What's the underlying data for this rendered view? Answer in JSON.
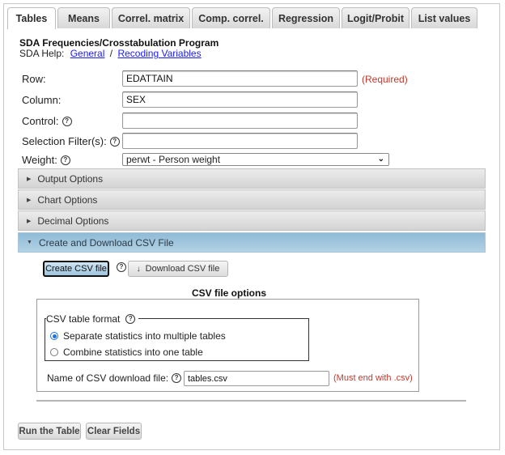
{
  "tabs": [
    {
      "label": "Tables",
      "active": true
    },
    {
      "label": "Means",
      "active": false
    },
    {
      "label": "Correl. matrix",
      "active": false
    },
    {
      "label": "Comp. correl.",
      "active": false
    },
    {
      "label": "Regression",
      "active": false
    },
    {
      "label": "Logit/Probit",
      "active": false
    },
    {
      "label": "List values",
      "active": false
    }
  ],
  "header": {
    "title": "SDA Frequencies/Crosstabulation Program",
    "help_prefix": "SDA Help:",
    "help_links": [
      "General",
      "Recoding Variables"
    ],
    "help_separator": "/"
  },
  "form": {
    "row": {
      "label": "Row:",
      "value": "EDATTAIN",
      "note": "(Required)"
    },
    "column": {
      "label": "Column:",
      "value": "SEX"
    },
    "control": {
      "label": "Control:",
      "value": ""
    },
    "filter": {
      "label": "Selection Filter(s):",
      "value": ""
    },
    "weight": {
      "label": "Weight:",
      "selected": "perwt - Person weight"
    }
  },
  "icons": {
    "help": "?",
    "collapsed": "▶",
    "expanded": "▼",
    "download": "↓",
    "chevron": "⌄"
  },
  "accordion": [
    {
      "label": "Output Options",
      "open": false
    },
    {
      "label": "Chart Options",
      "open": false
    },
    {
      "label": "Decimal Options",
      "open": false
    },
    {
      "label": "Create and Download CSV File",
      "open": true
    }
  ],
  "csv": {
    "create_button": "Create CSV file",
    "download_button": "Download CSV file",
    "options_title": "CSV file options",
    "format_legend": "CSV table format",
    "format_options": [
      {
        "label": "Separate statistics into multiple tables",
        "checked": true
      },
      {
        "label": "Combine statistics into one table",
        "checked": false
      }
    ],
    "filename_label": "Name of CSV download file:",
    "filename_value": "tables.csv",
    "filename_note": "(Must end with .csv)"
  },
  "actions": {
    "run": "Run the Table",
    "clear": "Clear Fields"
  },
  "colors": {
    "accent_open": "#9ec5de",
    "required": "#c0392b",
    "link": "#1a1aff",
    "radio": "#1a73e8"
  }
}
